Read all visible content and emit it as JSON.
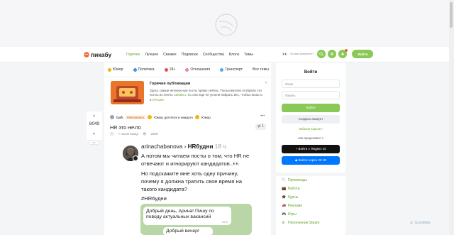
{
  "header": {
    "logo_text": "пикабу",
    "nav": [
      "Горячее",
      "Лучшее",
      "Свежее",
      "Подписки",
      "Сообщества",
      "Блоги",
      "Темы"
    ],
    "hint_text": "Что вам интересно?",
    "login_label": "Войти",
    "accent": "#8ac858"
  },
  "categories": [
    {
      "label": "Юмор",
      "color": "#f2b705"
    },
    {
      "label": "Политика",
      "color": "#4a90d9"
    },
    {
      "label": "18+",
      "color": "#e94e4e"
    },
    {
      "label": "Отношения",
      "color": "#f27ea9"
    },
    {
      "label": "Транспорт",
      "color": "#5aa9e6"
    },
    {
      "label": "Все темы",
      "color": ""
    }
  ],
  "hot": {
    "title": "Горячие публикации",
    "desc_before": "Здесь самые интересные посты прямо сейчас. Пользователи отобрали эти посты из ленты ",
    "desc_link1": "Свежего",
    "desc_middle": ", но они еще не успели набрать вес, чтобы попасть в ",
    "desc_link2": "Лучшее",
    "desc_after": "."
  },
  "vote": {
    "count": "8049"
  },
  "post": {
    "author": "bjafk",
    "badge": "Невозможно",
    "community": "Юмор для всех и каждого",
    "tag_community": "Юмор",
    "title": "HR это нечто",
    "pi": "pl 1",
    "time": "7 часов назад",
    "views": "250K"
  },
  "screenshot": {
    "name": "arinachabanova",
    "handle": "HR6удни",
    "time": "18 ч.",
    "text1": "А потом мы читаем посты о том, что HR не отвечают и игнорируют кандидатов..👀",
    "text2": "Но подскажите мне хоть одну причину, почему я должна тратить свое время на такого кандидата?",
    "tag": "#HR6удни",
    "bubble1": "Добрый день, Арина! Пишу по поводу актуальных вакансий",
    "bubble1_time": "16:47",
    "bubble2": "Добрый вечер!"
  },
  "login": {
    "title": "Войти",
    "login_placeholder": "Логин",
    "password_placeholder": "Пароль",
    "submit": "Войти",
    "create": "Создать аккаунт",
    "forgot": "Забыли пароль?",
    "or": "или продолжите с",
    "yandex": "Войти с Яндекс ID",
    "vk": "Войти через VK ID"
  },
  "side_links": [
    {
      "label": "Промокоды",
      "icon": "tag-icon"
    },
    {
      "label": "Работа",
      "icon": "briefcase-icon"
    },
    {
      "label": "Курсы",
      "icon": "graduation-icon"
    },
    {
      "label": "Реклама",
      "icon": "megaphone-icon"
    },
    {
      "label": "Игры",
      "icon": "gamepad-icon"
    },
    {
      "label": "Пополнение Steam",
      "icon": "steam-icon"
    }
  ],
  "watermark": "ScanMate"
}
